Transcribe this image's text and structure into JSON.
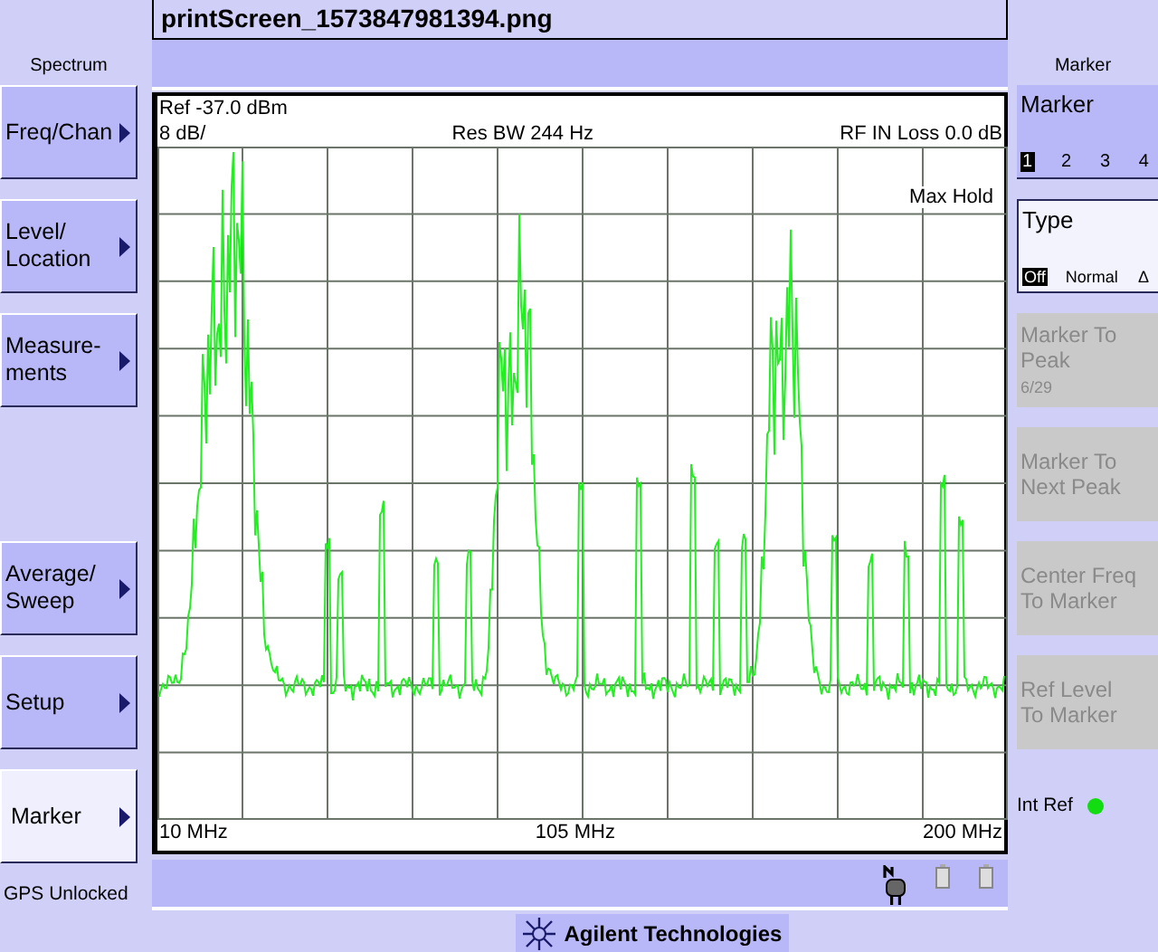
{
  "window": {
    "title": "printScreen_1573847981394.png"
  },
  "left_panel": {
    "heading": "Spectrum",
    "buttons": [
      {
        "label": "Freq/Chan",
        "selected": false
      },
      {
        "label": "Level/\nLocation",
        "selected": false
      },
      {
        "label": "Measure-\nments",
        "selected": false
      },
      {
        "label": "Average/\nSweep",
        "selected": false
      },
      {
        "label": "Setup",
        "selected": false
      },
      {
        "label": "Marker",
        "selected": true
      }
    ],
    "status": "GPS Unlocked"
  },
  "plot": {
    "ref": "Ref -37.0 dBm",
    "scale": "8 dB/",
    "res_bw": "Res BW 244 Hz",
    "loss": "RF IN Loss 0.0 dB",
    "trace_mode": "Max Hold",
    "x_start": "10 MHz",
    "x_center": "105 MHz",
    "x_end": "200 MHz"
  },
  "right_panel": {
    "heading": "Marker",
    "marker_select": {
      "label": "Marker",
      "options": [
        {
          "label": "1",
          "selected": true
        },
        {
          "label": "2",
          "selected": false
        },
        {
          "label": "3",
          "selected": false
        },
        {
          "label": "4",
          "selected": false
        }
      ]
    },
    "type_select": {
      "label": "Type",
      "options": [
        {
          "label": "Off",
          "selected": true
        },
        {
          "label": "Normal",
          "selected": false
        },
        {
          "label": "Δ",
          "selected": false
        }
      ]
    },
    "buttons": [
      {
        "label": "Marker To\nPeak",
        "sublabel": "6/29",
        "disabled": true
      },
      {
        "label": "Marker To\nNext Peak",
        "disabled": true
      },
      {
        "label": "Center Freq\nTo Marker",
        "disabled": true
      },
      {
        "label": "Ref Level\nTo Marker",
        "disabled": true
      }
    ],
    "status": "Int Ref",
    "int_ref_locked": true
  },
  "footer": {
    "logo": "Agilent Technologies"
  }
}
